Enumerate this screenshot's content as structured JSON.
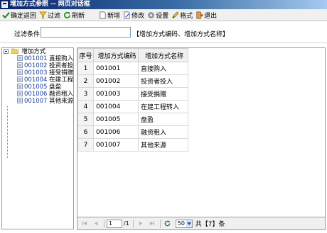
{
  "window": {
    "title": "增加方式参照 -- 网页对话框"
  },
  "toolbar": {
    "confirm": "确定返回",
    "filter": "过滤",
    "refresh": "刷新",
    "add": "新增",
    "edit": "修改",
    "setup": "设置",
    "format": "格式",
    "exit": "退出"
  },
  "filter": {
    "label": "过滤条件",
    "value": "",
    "hint": "【增加方式编码、增加方式名称】"
  },
  "tree": {
    "root": "增加方式",
    "items": [
      {
        "code": "001001",
        "name": "直接购入"
      },
      {
        "code": "001002",
        "name": "投资者投入"
      },
      {
        "code": "001003",
        "name": "接受捐赠"
      },
      {
        "code": "001004",
        "name": "在建工程转入"
      },
      {
        "code": "001005",
        "name": "盘盈"
      },
      {
        "code": "001006",
        "name": "融资租入"
      },
      {
        "code": "001007",
        "name": "其他来源"
      }
    ]
  },
  "table": {
    "headers": {
      "seq": "序号",
      "code": "增加方式编码",
      "name": "增加方式名称"
    },
    "rows": [
      {
        "seq": "1",
        "code": "001001",
        "name": "直接购入"
      },
      {
        "seq": "2",
        "code": "001002",
        "name": "投资者投入"
      },
      {
        "seq": "3",
        "code": "001003",
        "name": "接受捐赠"
      },
      {
        "seq": "4",
        "code": "001004",
        "name": "在建工程转入"
      },
      {
        "seq": "5",
        "code": "001005",
        "name": "盘盈"
      },
      {
        "seq": "6",
        "code": "001006",
        "name": "融资租入"
      },
      {
        "seq": "7",
        "code": "001007",
        "name": "其他来源"
      }
    ]
  },
  "pager": {
    "page": "1",
    "total_pages": "/1",
    "page_size": "50",
    "count_text": "共【7】条"
  }
}
